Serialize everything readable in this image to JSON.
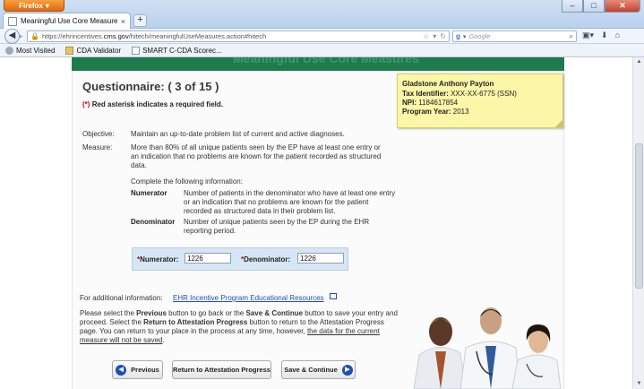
{
  "browser": {
    "menu_label": "Firefox",
    "tab_title": "Meaningful Use Core Measures - EHR In...",
    "tab_close": "×",
    "new_tab": "+",
    "url_prefix": "https://ehrincentives.",
    "url_domain": "cms.gov",
    "url_suffix": "/hitech/meaningfulUseMeasures.action#hitech",
    "search_engine": "g",
    "search_placeholder": "Google",
    "bookmarks": [
      "Most Visited",
      "CDA Validator",
      "SMART C-CDA Scorec..."
    ]
  },
  "questionnaire": {
    "title": "Questionnaire: ( 3 of 15 )",
    "required_open": "(",
    "required_star": "*",
    "required_close": ")",
    "required_text": " Red asterisk indicates a required field.",
    "objective_label": "Objective:",
    "objective_text": "Maintain an up-to-date problem list of current and active diagnoses.",
    "measure_label": "Measure:",
    "measure_text": "More than 80% of all unique patients seen by the EP have at least one entry or an indication that no problems are known for the patient recorded as structured data.",
    "complete_text": "Complete the following information:",
    "numerator_term": "Numerator",
    "numerator_desc": "Number of patients in the denominator who have at least one entry or an indication that no problems are known for the patient recorded as structured data in their problem list.",
    "denominator_term": "Denominator",
    "denominator_desc": "Number of unique patients seen by the EP during the EHR reporting period.",
    "numerator_label": "Numerator:",
    "numerator_value": "1226",
    "denominator_label": "Denominator:",
    "denominator_value": "1226",
    "star": "*"
  },
  "info": {
    "label": "For additional information:",
    "link": "EHR Incentive Program Educational Resources"
  },
  "instructions": {
    "p1": "Please select the ",
    "b1": "Previous",
    "p2": " button to go back or the ",
    "b2": "Save & Continue",
    "p3": " button to save your entry and proceed. Select the ",
    "b3": "Return to Attestation Progress",
    "p4": " button to return to the Attestation Progress page. You can return to your place in the process at any time, however, ",
    "u1": "the data for the current measure will not be saved",
    "p5": "."
  },
  "buttons": {
    "previous": "Previous",
    "return": "Return to Attestation Progress",
    "save": "Save & Continue"
  },
  "provider": {
    "name": "Gladstone Anthony Payton",
    "tax_label": "Tax Identifier:",
    "tax_value": " XXX-XX-6775 (SSN)",
    "npi_label": "NPI:",
    "npi_value": " 1184617854",
    "year_label": "Program Year:",
    "year_value": " 2013"
  },
  "colors": {
    "header_green": "#1f7a4c",
    "link_blue": "#1d4fb5",
    "required_red": "#cc0000",
    "sticky_yellow": "#fbf6a8"
  }
}
